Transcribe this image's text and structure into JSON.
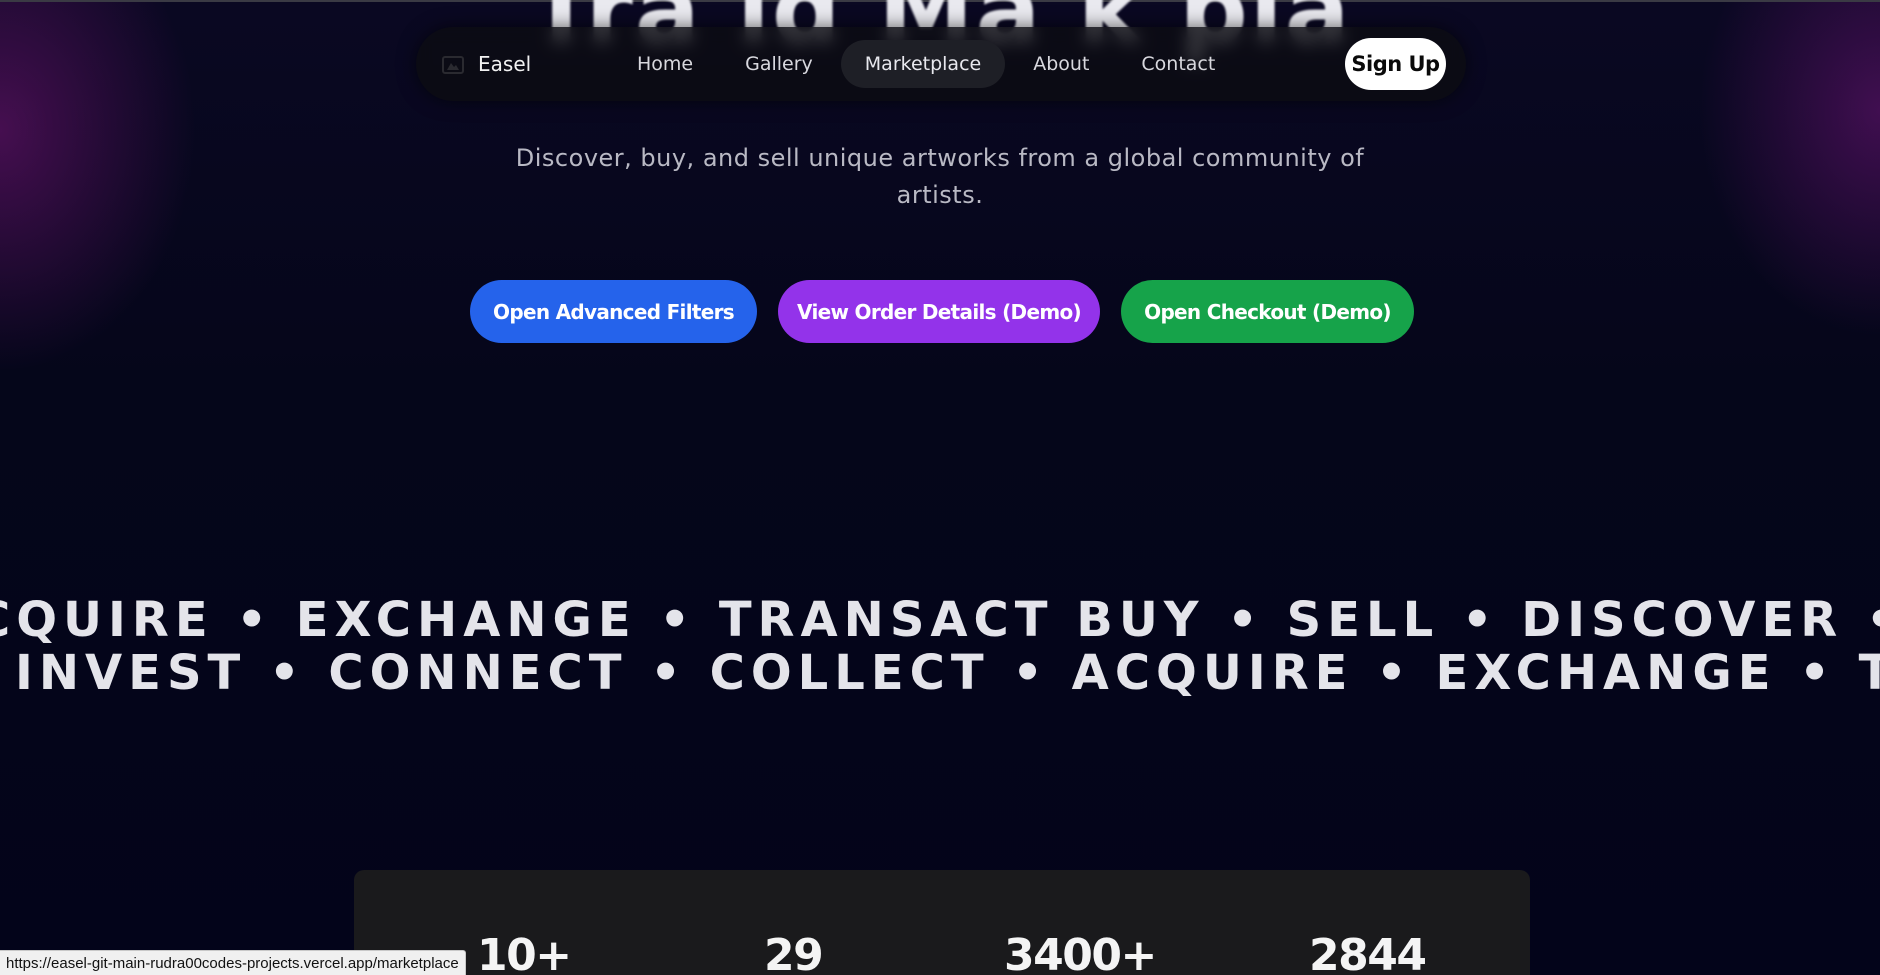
{
  "hero": {
    "title_partial": "Tra  ld Ma  k  pla",
    "subtitle": "Discover, buy, and sell unique artworks from a global community of artists."
  },
  "nav": {
    "brand": "Easel",
    "brand_icon": "gallery-frame-icon",
    "links": [
      "Home",
      "Gallery",
      "Marketplace",
      "About",
      "Contact"
    ],
    "active": "Marketplace",
    "signup": "Sign Up"
  },
  "actions": {
    "filters": "Open Advanced Filters",
    "order": "View Order Details (Demo)",
    "checkout": "Open Checkout (Demo)"
  },
  "marquee": {
    "row1": "CQUIRE • EXCHANGE • TRANSACT BUY • SELL • DISCOVER • TRA",
    "row2": "INVEST • CONNECT • COLLECT • ACQUIRE • EXCHANGE • TRANS"
  },
  "stats": [
    "10+",
    "29",
    "3400+",
    "2844"
  ],
  "status_bar": {
    "url": "https://easel-git-main-rudra00codes-projects.vercel.app/marketplace"
  },
  "colors": {
    "background": "#04051a",
    "filters_button": "#2563eb",
    "order_button": "#9333ea",
    "checkout_button": "#16a34a",
    "signup_button": "#ffffff"
  }
}
